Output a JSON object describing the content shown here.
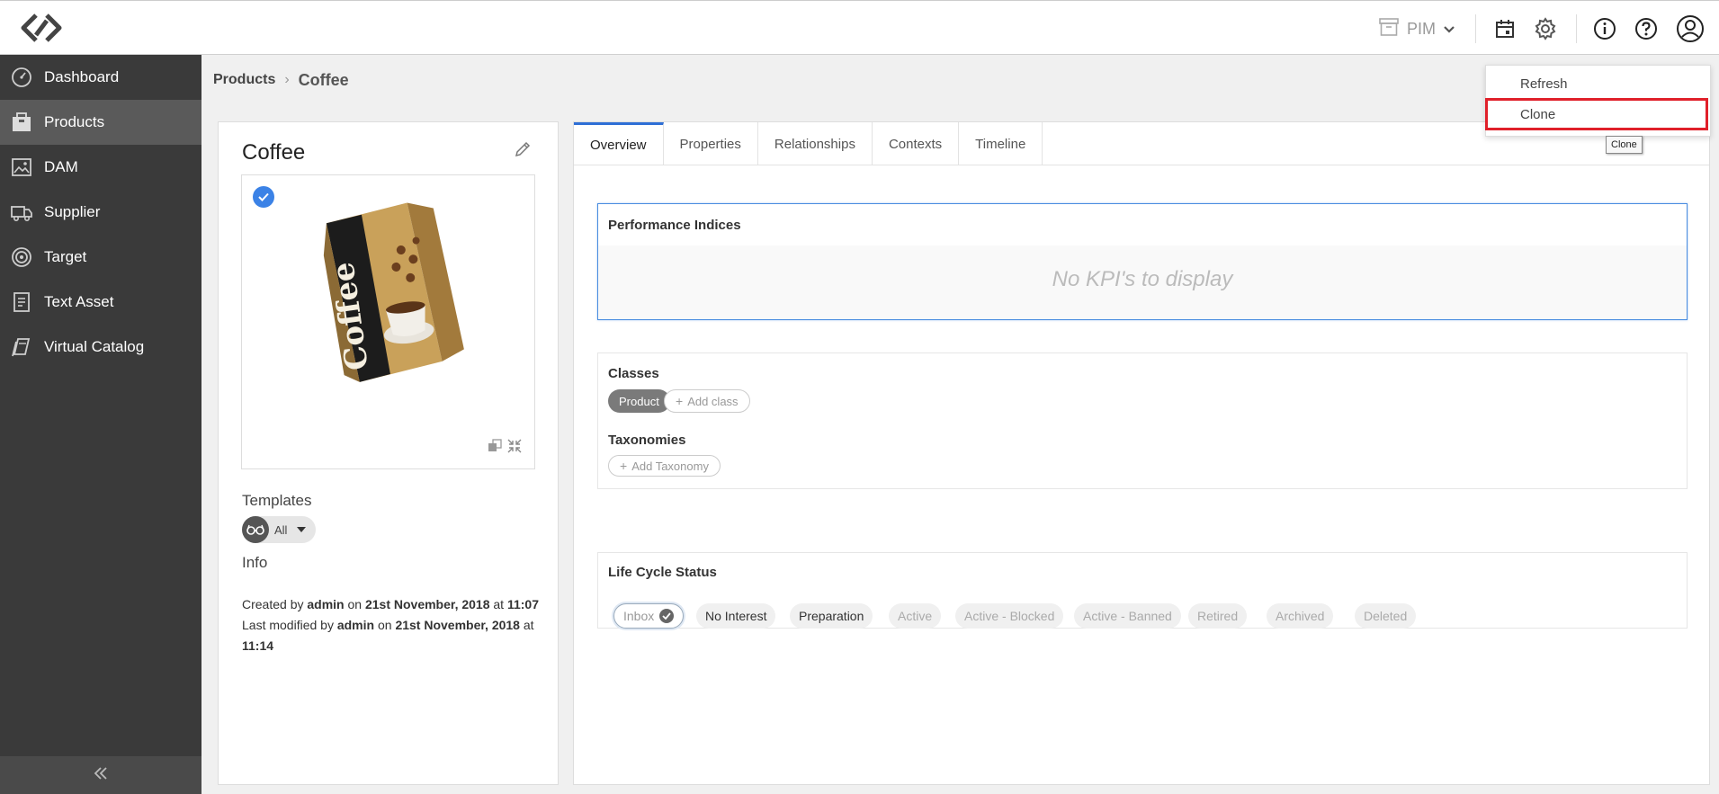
{
  "topbar": {
    "app_switch_label": "PIM"
  },
  "sidebar": {
    "items": [
      {
        "label": "Dashboard",
        "icon": "dashboard-icon"
      },
      {
        "label": "Products",
        "icon": "products-icon",
        "active": true
      },
      {
        "label": "DAM",
        "icon": "image-icon"
      },
      {
        "label": "Supplier",
        "icon": "truck-icon"
      },
      {
        "label": "Target",
        "icon": "target-icon"
      },
      {
        "label": "Text Asset",
        "icon": "document-icon"
      },
      {
        "label": "Virtual Catalog",
        "icon": "catalog-icon"
      }
    ]
  },
  "breadcrumb": {
    "parent": "Products",
    "current": "Coffee"
  },
  "product": {
    "title": "Coffee",
    "image_text": "Coffee",
    "templates_label": "Templates",
    "templates_value": "All",
    "info_label": "Info",
    "created_prefix": "Created by",
    "created_by": "admin",
    "created_on_word": "on",
    "created_date": "21st November, 2018",
    "created_at_word": "at",
    "created_time": "11:07",
    "modified_prefix": "Last modified by",
    "modified_by": "admin",
    "modified_on_word": "on",
    "modified_date": "21st November, 2018",
    "modified_at_word": "at",
    "modified_time": "11:14"
  },
  "tabs": [
    "Overview",
    "Properties",
    "Relationships",
    "Contexts",
    "Timeline"
  ],
  "performance": {
    "title": "Performance Indices",
    "empty_text": "No KPI's to display"
  },
  "classes": {
    "title": "Classes",
    "items": [
      "Product"
    ],
    "add_label": "Add class"
  },
  "taxonomies": {
    "title": "Taxonomies",
    "add_label": "Add Taxonomy"
  },
  "lifecycle": {
    "title": "Life Cycle Status",
    "statuses": [
      "Inbox",
      "No Interest",
      "Preparation",
      "Active",
      "Active - Blocked",
      "Active - Banned",
      "Retired",
      "Archived",
      "Deleted"
    ]
  },
  "dropdown": {
    "items": [
      "Refresh",
      "Clone"
    ],
    "tooltip": "Clone"
  },
  "colors": {
    "sidebar_bg": "#3a3a3a",
    "sidebar_active": "#5a5a5a",
    "accent": "#2e6fd6",
    "highlight_border": "#e0202a"
  }
}
